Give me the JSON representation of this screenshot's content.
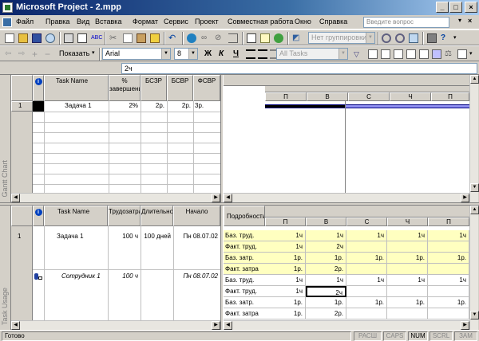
{
  "window": {
    "title": "Microsoft Project - 2.mpp",
    "min": "_",
    "max": "□",
    "close": "×"
  },
  "menu": {
    "items": [
      "Файл",
      "Правка",
      "Вид",
      "Вставка",
      "Формат",
      "Сервис",
      "Проект",
      "Совместная работа",
      "Окно",
      "Справка"
    ],
    "ask": "Введите вопрос",
    "doc_close": "×"
  },
  "toolbar1": {
    "group_combo": "Нет группировки",
    "icons": [
      "new-icon",
      "open-icon",
      "save-icon",
      "search-doc-icon",
      "print-icon",
      "print-preview-icon",
      "spelling-icon",
      "cut-icon",
      "copy-icon",
      "paste-icon",
      "format-painter-icon",
      "undo-icon",
      "hyperlink-icon",
      "link-tasks-icon",
      "unlink-tasks-icon",
      "split-task-icon",
      "task-info-icon",
      "notes-icon",
      "assign-resources-icon",
      "zoom-in-icon",
      "zoom-out-icon",
      "goto-task-icon",
      "copy-picture-icon",
      "help-icon"
    ]
  },
  "toolbar2": {
    "show_label": "Показать",
    "font": "Arial",
    "size": "8",
    "bold": "Ж",
    "italic": "К",
    "underline": "Ч",
    "filter": "All Tasks"
  },
  "entry": {
    "value": "2ч"
  },
  "gantt": {
    "view_label": "Gantt Chart",
    "columns": [
      "Task Name",
      "% завершения",
      "БСЗР",
      "БСВР",
      "ФСВР"
    ],
    "rows": [
      {
        "id": "1",
        "name": "Задача 1",
        "pct": "2%",
        "bszr": "2р.",
        "bsvr": "2р.",
        "fsvr": "3р."
      }
    ],
    "timescale": [
      "П",
      "В",
      "С",
      "Ч",
      "П"
    ]
  },
  "usage": {
    "view_label": "Task Usage",
    "columns": [
      "Task Name",
      "Трудозатраты",
      "Длительность",
      "Начало"
    ],
    "detail_header": "Подробности",
    "timescale": [
      "П",
      "В",
      "С",
      "Ч",
      "П"
    ],
    "rows": [
      {
        "id": "1",
        "name": "Задача 1",
        "work": "100 ч",
        "dur": "100 дней",
        "start": "Пн 08.07.02",
        "details": [
          {
            "label": "Баз. труд.",
            "values": [
              "1ч",
              "1ч",
              "1ч",
              "1ч",
              "1ч"
            ]
          },
          {
            "label": "Факт. труд.",
            "values": [
              "1ч",
              "2ч",
              "",
              "",
              ""
            ]
          },
          {
            "label": "Баз. затр.",
            "values": [
              "1р.",
              "1р.",
              "1р.",
              "1р.",
              "1р."
            ]
          },
          {
            "label": "Факт. затра",
            "values": [
              "1р.",
              "2р.",
              "",
              "",
              ""
            ]
          }
        ]
      },
      {
        "id": "",
        "name": "Сотрудник 1",
        "work": "100 ч",
        "dur": "",
        "start": "Пн 08.07.02",
        "details": [
          {
            "label": "Баз. труд.",
            "values": [
              "1ч",
              "1ч",
              "1ч",
              "1ч",
              "1ч"
            ]
          },
          {
            "label": "Факт. труд.",
            "values": [
              "1ч",
              "2ч",
              "",
              "",
              ""
            ]
          },
          {
            "label": "Баз. затр.",
            "values": [
              "1р.",
              "1р.",
              "1р.",
              "1р.",
              "1р."
            ]
          },
          {
            "label": "Факт. затра",
            "values": [
              "1р.",
              "2р.",
              "",
              "",
              ""
            ]
          }
        ]
      }
    ]
  },
  "status": {
    "ready": "Готово",
    "indicators": [
      "РАСШ",
      "CAPS",
      "NUM",
      "SCRL",
      "ЗАМ"
    ]
  }
}
